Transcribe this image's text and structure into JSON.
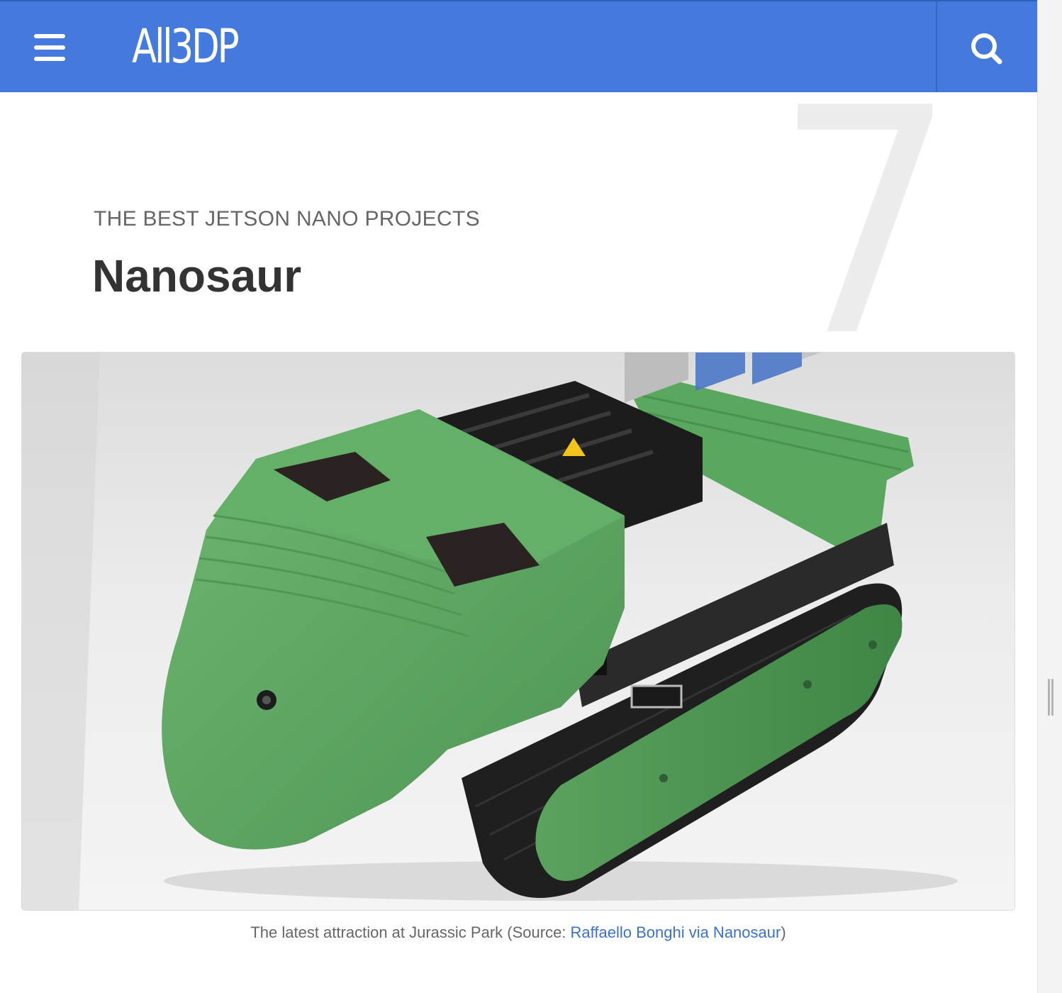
{
  "header": {
    "brand": "All3DP",
    "menu_icon": "hamburger-menu-icon",
    "search_icon": "search-icon",
    "brand_color": "#4479dd"
  },
  "article": {
    "number": "7",
    "kicker": "THE BEST JETSON NANO PROJECTS",
    "title": "Nanosaur"
  },
  "figure": {
    "image_subject": "green 3D-printed tracked robot with Jetson Nano board",
    "caption_prefix": "The latest attraction at Jurassic Park (Source: ",
    "caption_link": "Raffaello Bonghi via Nanosaur",
    "caption_suffix": ")",
    "link_color": "#3a6fd6"
  }
}
